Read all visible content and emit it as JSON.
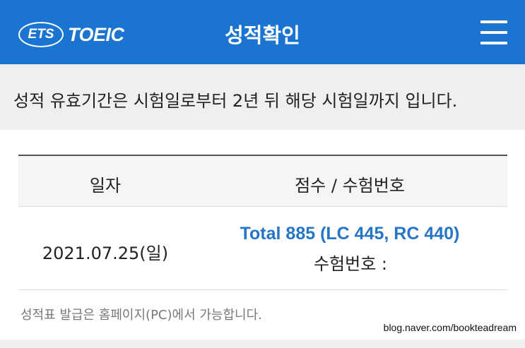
{
  "header": {
    "logo_ets": "ETS",
    "logo_toeic": "TOEIC",
    "title": "성적확인",
    "menu_icon": "hamburger-menu-icon"
  },
  "notice": {
    "text": "성적 유효기간은 시험일로부터 2년 뒤 해당 시험일까지 입니다."
  },
  "table": {
    "columns": [
      "일자",
      "점수 / 수험번호"
    ],
    "rows": [
      {
        "date": "2021.07.25(일)",
        "score": "Total 885 (LC 445, RC 440)",
        "exam_number_label": "수험번호 :"
      }
    ]
  },
  "footnote": "성적표 발급은 홈페이지(PC)에서 가능합니다.",
  "watermark": "blog.naver.com/bookteadream",
  "colors": {
    "header_bg": "#1b75d0",
    "score_link": "#2675c6",
    "notice_bg": "#efefef"
  }
}
